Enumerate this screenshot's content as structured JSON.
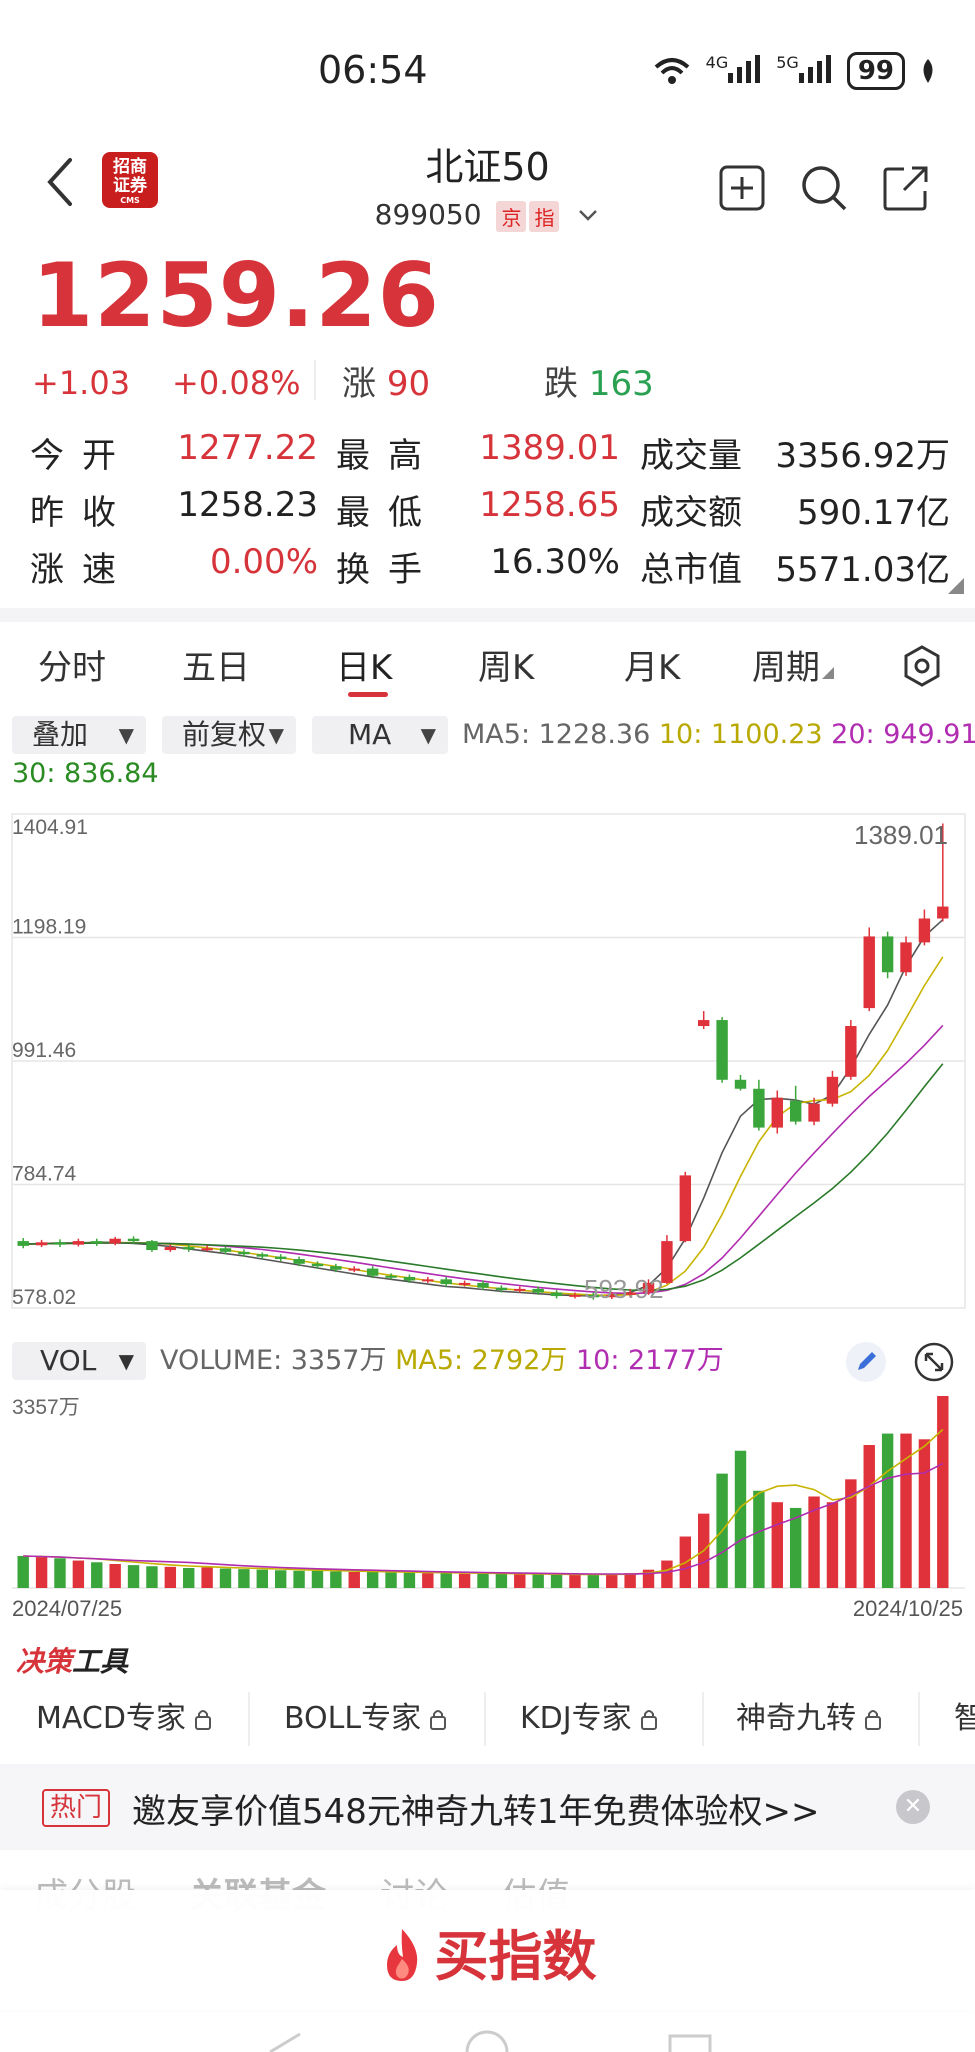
{
  "status": {
    "time": "06:54",
    "battery": "99",
    "net1": "4G",
    "net2": "5G"
  },
  "header": {
    "title": "北证50",
    "code": "899050",
    "tag1": "京",
    "tag2": "指",
    "logo_line1": "招商",
    "logo_line2": "证券",
    "logo_line3": "CMS"
  },
  "quote": {
    "price": "1259.26",
    "change": "+1.03",
    "change_pct": "+0.08%",
    "up_label": "涨",
    "up_count": "90",
    "down_label": "跌",
    "down_count": "163"
  },
  "stats": {
    "open_label": "今开",
    "open": "1277.22",
    "high_label": "最高",
    "high": "1389.01",
    "volume_label": "成交量",
    "volume": "3356.92万",
    "prev_label": "昨收",
    "prev": "1258.23",
    "low_label": "最低",
    "low": "1258.65",
    "amount_label": "成交额",
    "amount": "590.17亿",
    "speed_label": "涨速",
    "speed": "0.00%",
    "turnover_label": "换手",
    "turnover": "16.30%",
    "mcap_label": "总市值",
    "mcap": "5571.03亿"
  },
  "tabs": [
    "分时",
    "五日",
    "日K",
    "周K",
    "月K",
    "周期"
  ],
  "active_tab": "日K",
  "indicators": {
    "overlay": "叠加",
    "adjust": "前复权",
    "ma": "MA",
    "ma5": "MA5: 1228.36",
    "ma10": "10: 1100.23",
    "ma20": "20: 949.91",
    "ma30": "30: 836.84"
  },
  "price_axis": [
    "1404.91",
    "1198.19",
    "991.46",
    "784.74",
    "578.02"
  ],
  "high_marker": "1389.01",
  "low_marker": "593.92",
  "volume_panel": {
    "dropdown": "VOL",
    "volume": "VOLUME: 3357万",
    "ma5": "MA5: 2792万",
    "ma10": "10: 2177万",
    "max_label": "3357万",
    "start_date": "2024/07/25",
    "end_date": "2024/10/25"
  },
  "colors": {
    "up": "#e0323a",
    "down": "#3aa53a",
    "ma5": "#555555",
    "ma10": "#c8b400",
    "ma20": "#b02cb0",
    "ma30": "#2a7a2a"
  },
  "chart_data": {
    "type": "candlestick",
    "ylim": [
      578.02,
      1404.91
    ],
    "x_start": "2024/07/25",
    "x_end": "2024/10/25",
    "candles": [
      [
        690,
        682,
        695,
        678
      ],
      [
        683,
        688,
        692,
        680
      ],
      [
        688,
        684,
        693,
        680
      ],
      [
        684,
        690,
        694,
        681
      ],
      [
        690,
        686,
        694,
        682
      ],
      [
        686,
        694,
        697,
        683
      ],
      [
        694,
        690,
        698,
        686
      ],
      [
        690,
        675,
        692,
        672
      ],
      [
        675,
        680,
        684,
        672
      ],
      [
        680,
        676,
        684,
        672
      ],
      [
        676,
        678,
        683,
        673
      ],
      [
        678,
        672,
        681,
        668
      ],
      [
        672,
        668,
        676,
        664
      ],
      [
        668,
        664,
        671,
        660
      ],
      [
        664,
        660,
        668,
        656
      ],
      [
        660,
        652,
        664,
        648
      ],
      [
        652,
        648,
        656,
        644
      ],
      [
        648,
        642,
        652,
        638
      ],
      [
        642,
        644,
        648,
        638
      ],
      [
        644,
        632,
        648,
        628
      ],
      [
        632,
        630,
        636,
        626
      ],
      [
        630,
        624,
        634,
        620
      ],
      [
        624,
        626,
        630,
        620
      ],
      [
        626,
        618,
        630,
        614
      ],
      [
        618,
        620,
        624,
        614
      ],
      [
        620,
        612,
        624,
        608
      ],
      [
        612,
        608,
        616,
        604
      ],
      [
        608,
        610,
        614,
        604
      ],
      [
        610,
        604,
        614,
        600
      ],
      [
        604,
        598,
        608,
        594
      ],
      [
        598,
        600,
        604,
        594
      ],
      [
        600,
        596,
        604,
        592
      ],
      [
        596,
        600,
        605,
        593
      ],
      [
        600,
        604,
        610,
        596
      ],
      [
        604,
        620,
        626,
        600
      ],
      [
        620,
        690,
        700,
        618
      ],
      [
        690,
        800,
        806,
        688
      ],
      [
        1050,
        1060,
        1075,
        1045
      ],
      [
        1060,
        960,
        1065,
        955
      ],
      [
        960,
        945,
        968,
        942
      ],
      [
        945,
        880,
        960,
        875
      ],
      [
        880,
        930,
        942,
        870
      ],
      [
        925,
        890,
        950,
        885
      ],
      [
        890,
        920,
        930,
        884
      ],
      [
        920,
        965,
        975,
        915
      ],
      [
        965,
        1050,
        1060,
        960
      ],
      [
        1080,
        1200,
        1215,
        1075
      ],
      [
        1200,
        1140,
        1208,
        1130
      ],
      [
        1140,
        1190,
        1200,
        1134
      ],
      [
        1190,
        1230,
        1245,
        1185
      ],
      [
        1230,
        1250,
        1389,
        1225
      ]
    ],
    "volume": [
      560,
      540,
      520,
      480,
      450,
      420,
      400,
      380,
      370,
      350,
      360,
      340,
      330,
      320,
      310,
      300,
      300,
      290,
      280,
      280,
      270,
      270,
      260,
      260,
      250,
      250,
      250,
      240,
      240,
      230,
      230,
      240,
      250,
      260,
      320,
      480,
      900,
      1300,
      2000,
      2400,
      1700,
      1500,
      1400,
      1600,
      1500,
      1900,
      2500,
      2700,
      2700,
      2600,
      3357
    ],
    "ma5": [
      685,
      686,
      687,
      687,
      688,
      688,
      686,
      684,
      681,
      677,
      673,
      669,
      665,
      660,
      655,
      650,
      645,
      640,
      635,
      630,
      626,
      622,
      618,
      614,
      612,
      609,
      606,
      604,
      602,
      600,
      599,
      598,
      600,
      604,
      616,
      645,
      694,
      762,
      838,
      899,
      927,
      929,
      926,
      919,
      935,
      980,
      1036,
      1085,
      1150,
      1200,
      1228
    ]
  }
}
